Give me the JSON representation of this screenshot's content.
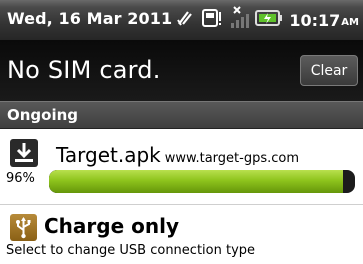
{
  "status_bar": {
    "date": "Wed, 16 Mar 2011",
    "time": "10:17",
    "ampm": "AM",
    "icons": [
      "usb-debug-icon",
      "sd-card-icon",
      "no-signal-icon",
      "battery-charging-icon"
    ]
  },
  "header": {
    "title": "No SIM card.",
    "clear_label": "Clear"
  },
  "section": {
    "label": "Ongoing"
  },
  "notifications": [
    {
      "icon": "download-icon",
      "title": "Target.apk",
      "source": "www.target-gps.com",
      "progress_label": "96%",
      "progress_fraction": 0.96
    },
    {
      "icon": "usb-icon",
      "title": "Charge only",
      "subtitle": "Select to change USB connection type"
    }
  ],
  "colors": {
    "progress_fill": "#8ec41d",
    "header_bg": "#111111"
  }
}
